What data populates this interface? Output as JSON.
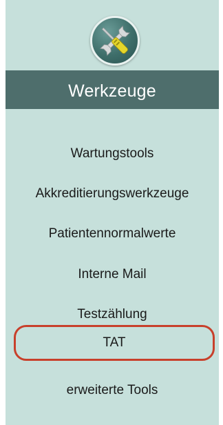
{
  "header": {
    "icon": "wrench-screwdriver-icon",
    "title": "Werkzeuge"
  },
  "menu": {
    "items": [
      {
        "label": "Wartungstools"
      },
      {
        "label": "Akkreditierungswerkzeuge"
      },
      {
        "label": "Patientennormalwerte"
      },
      {
        "label": "Interne Mail"
      },
      {
        "label": "Testzählung"
      },
      {
        "label": "TAT"
      },
      {
        "label": "erweiterte Tools"
      }
    ]
  },
  "colors": {
    "panel_background": "#c6e0db",
    "title_bar": "#4e6e6c",
    "highlight_border": "#c8402b",
    "icon_circle": "#3e6e6a"
  }
}
